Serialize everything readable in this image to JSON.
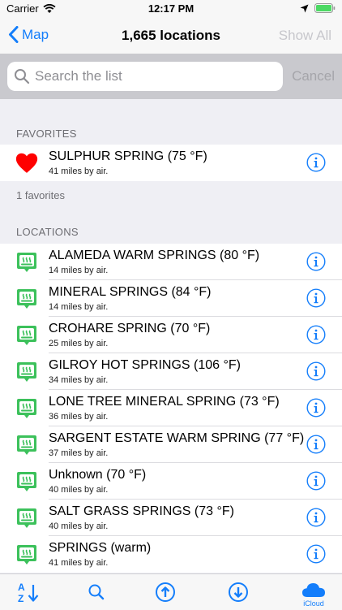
{
  "status": {
    "carrier": "Carrier",
    "time": "12:17 PM"
  },
  "nav": {
    "back_label": "Map",
    "title": "1,665 locations",
    "right_label": "Show All"
  },
  "search": {
    "placeholder": "Search the list",
    "cancel_label": "Cancel"
  },
  "favorites": {
    "header": "FAVORITES",
    "items": [
      {
        "title": "SULPHUR SPRING (75 °F)",
        "subtitle": "41 miles by air."
      }
    ],
    "footer": "1 favorites"
  },
  "locations": {
    "header": "LOCATIONS",
    "items": [
      {
        "title": "ALAMEDA WARM SPRINGS (80 °F)",
        "subtitle": "14 miles by air."
      },
      {
        "title": "MINERAL SPRINGS (84 °F)",
        "subtitle": "14 miles by air."
      },
      {
        "title": "CROHARE SPRING (70 °F)",
        "subtitle": "25 miles by air."
      },
      {
        "title": "GILROY HOT SPRINGS (106 °F)",
        "subtitle": "34 miles by air."
      },
      {
        "title": "LONE TREE MINERAL SPRING (73 °F)",
        "subtitle": "36 miles by air."
      },
      {
        "title": "SARGENT ESTATE WARM SPRING (77 °F)",
        "subtitle": "37 miles by air."
      },
      {
        "title": "Unknown (70 °F)",
        "subtitle": "40 miles by air."
      },
      {
        "title": "SALT GRASS SPRINGS (73 °F)",
        "subtitle": "40 miles by air."
      },
      {
        "title": "SPRINGS (warm)",
        "subtitle": "41 miles by air."
      }
    ]
  },
  "tabbar": {
    "icloud_label": "iCloud"
  },
  "icons": {
    "heart": "heart-icon",
    "spring": "hot-spring-pin-icon",
    "info": "info-icon",
    "sort": "sort-az-icon",
    "search": "search-icon",
    "upload": "upload-icon",
    "download": "download-icon",
    "icloud": "icloud-icon"
  },
  "colors": {
    "accent": "#147efb",
    "heart": "#ff0000",
    "spring_pin": "#3cc15b"
  }
}
